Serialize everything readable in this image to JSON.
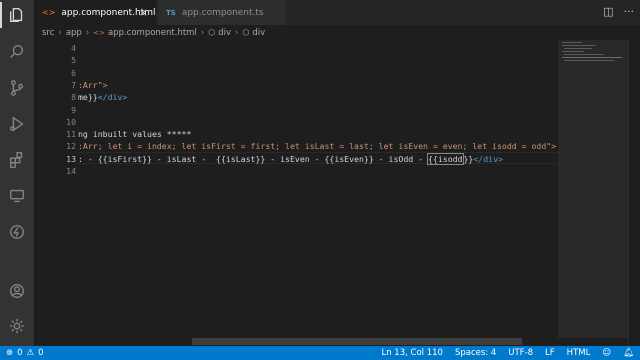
{
  "tabs": [
    {
      "icon": "<>",
      "label": "app.component.html",
      "close": "×"
    },
    {
      "icon": "TS",
      "label": "app.component.ts"
    }
  ],
  "tab_actions": {
    "split": "◫",
    "more": "···"
  },
  "breadcrumb": [
    "src",
    "app",
    "app.component.html",
    "div",
    "div"
  ],
  "lines": [
    {
      "num": "4"
    },
    {
      "num": "5"
    },
    {
      "num": "6"
    },
    {
      "num": "7",
      "text": ":Arr\">"
    },
    {
      "num": "8",
      "text_a": "me}}",
      "text_b": "</div>"
    },
    {
      "num": "9"
    },
    {
      "num": "10"
    },
    {
      "num": "11",
      "text": "ng inbuilt values *****"
    },
    {
      "num": "12",
      "text": ":Arr; let i = index; let isFirst = first; let isLast = last; let isEven = even; let isodd = odd\">"
    },
    {
      "num": "13",
      "text_a": ": - {{isFirst}} - isLast -  {{isLast}} - isEven - {{isEven}} - isOdd - ",
      "text_b": "{{isodd",
      "text_c": "}}",
      "text_d": "</div>"
    },
    {
      "num": "14"
    }
  ],
  "status": {
    "errors": "0",
    "warnings": "0",
    "position": "Ln 13, Col 110",
    "spaces": "Spaces: 4",
    "encoding": "UTF-8",
    "eol": "LF",
    "language": "HTML",
    "feedback_icon": "person-feedback-icon",
    "bell_icon": "bell-icon"
  },
  "colors": {
    "statusbar": "#007acc",
    "activitybar": "#333333",
    "editor": "#1e1e1e",
    "string": "#ce9178",
    "tag": "#569cd6"
  }
}
